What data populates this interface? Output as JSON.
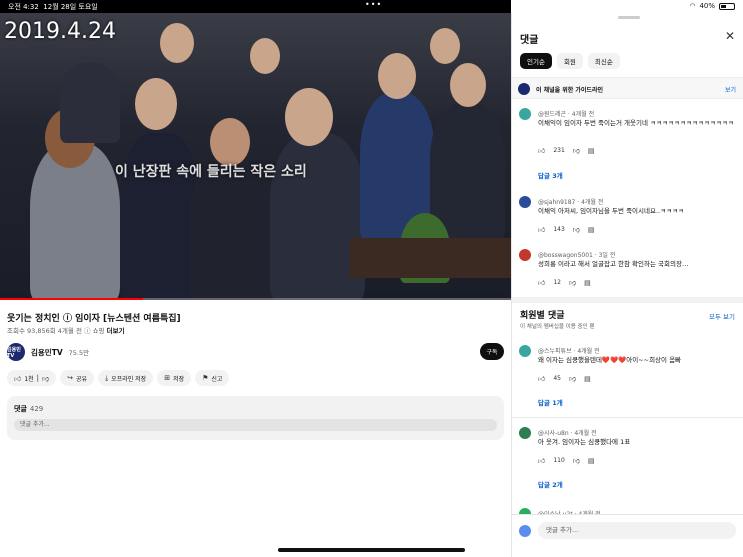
{
  "status": {
    "time": "오전 4:32",
    "date": "12월 28일 토요일",
    "dots": "•••",
    "battery": "40%"
  },
  "video": {
    "date_overlay": "2019.4.24",
    "channel_watermark": "엠빅뉴스",
    "caption_overlay": "이 난장판 속에 들리는 작은 소리",
    "progress": 0.28,
    "title": "웃기는 정치인 ⓘ 임이자 [뉴스텐션 여름특집]",
    "meta": "조회수 93,856회  4개월 전  ⓘ 쇼핑",
    "more_label": "더보기"
  },
  "channel": {
    "avatar_text": "김용민TV",
    "name": "김용민TV",
    "subs": "75.5만",
    "subscribe_label": "구독"
  },
  "actions": [
    {
      "icon": "thumbs-up-icon",
      "label": "1천"
    },
    {
      "icon": "share-icon",
      "label": "공유"
    },
    {
      "icon": "download-icon",
      "label": "오프라인 저장"
    },
    {
      "icon": "save-icon",
      "label": "저장"
    },
    {
      "icon": "flag-icon",
      "label": "신고"
    }
  ],
  "comments_box": {
    "title": "댓글",
    "count": "429",
    "placeholder": "댓글 추가..."
  },
  "panel": {
    "title": "댓글",
    "close_icon": "✕",
    "chips": [
      "인기순",
      "회원",
      "최신순"
    ],
    "guide_text": "이 채널을 위한 가이드라인",
    "guide_link": "보기",
    "comments": [
      {
        "author": "@원드레곤 · 4개월 전",
        "text": "이채익이 임이자 두번 죽이는거 개웃기네 ㅋㅋㅋㅋㅋㅋㅋㅋㅋㅋㅋㅋㅋㅋ",
        "likes": "231",
        "reply": "답글 3개",
        "color": "#3aa6a0"
      },
      {
        "author": "@sjahn9187 · 4개월 전",
        "text": "이채익 아저씨, 임이자님을 두번 죽이시네요..ㅋㅋㅋㅋ",
        "likes": "143",
        "reply": "",
        "color": "#2b4b9b"
      },
      {
        "author": "@bosswagon5001 · 3일 전",
        "text": "성희롱 이라고 해서 얼굴잡고 한참 확인하는 국회의장…",
        "likes": "12",
        "reply": "",
        "color": "#c0392b"
      }
    ],
    "members_title": "회원별 댓글",
    "members_sub": "이 채널의 멤버십을 이용 중인 팬",
    "members_link": "모두 보기",
    "member_comments": [
      {
        "author": "@스누피튜브 · 4개월 전",
        "text": "왜 이자는 심쿵했을텐데❤️❤️❤️아이~~희상이 옴빠",
        "likes": "45",
        "reply": "답글 1개",
        "color": "#3aa6a0"
      },
      {
        "author": "@시사-u8n · 4개월 전",
        "text": "아 웃겨. 임이자는 심쿵했다에 1표",
        "likes": "110",
        "reply": "답글 2개",
        "color": "#2e7d4f"
      },
      {
        "author": "@이스낭-u2t · 4개월 전",
        "text": "",
        "likes": "",
        "reply": "",
        "color": "#27ae60"
      }
    ],
    "input_placeholder": "댓글 추가..."
  }
}
